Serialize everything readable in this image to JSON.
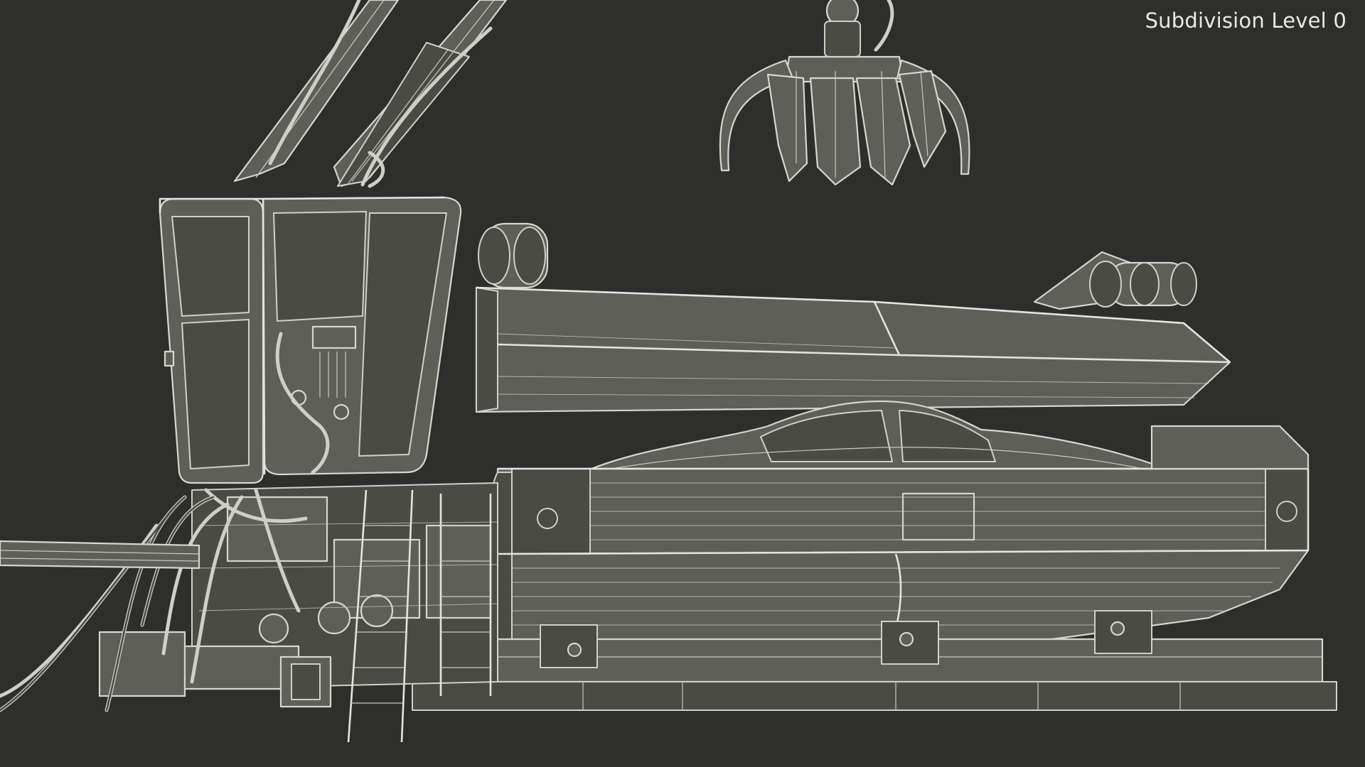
{
  "viewport": {
    "overlay_label": "Subdivision Level 0",
    "background_color": "#2e2e2c",
    "wireframe_color": "#d6d6cf",
    "surface_color": "#5f5f59"
  }
}
